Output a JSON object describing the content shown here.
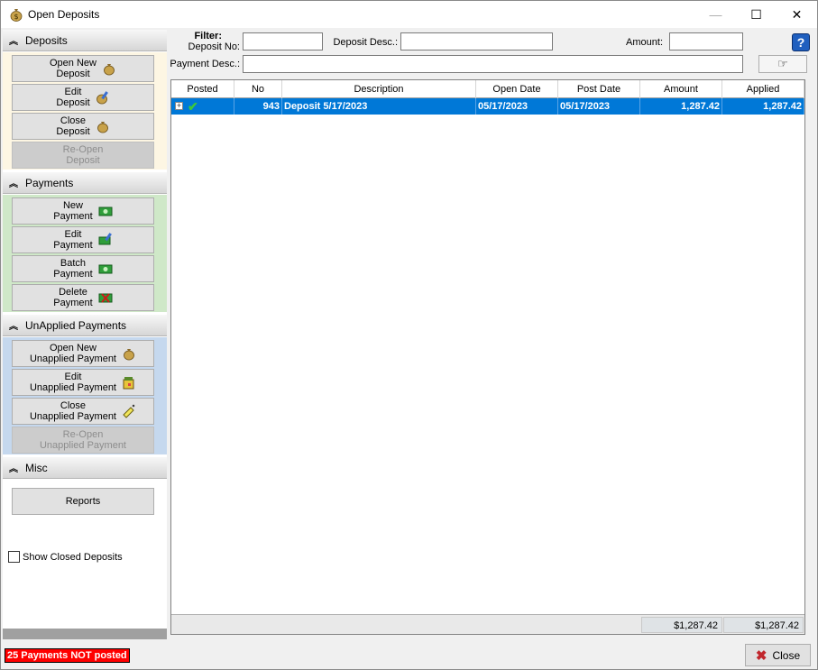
{
  "window": {
    "title": "Open Deposits"
  },
  "nav": {
    "deposits": {
      "title": "Deposits",
      "buttons": [
        {
          "label1": "Open New",
          "label2": "Deposit",
          "icon": "money-bag-icon",
          "disabled": false
        },
        {
          "label1": "Edit",
          "label2": "Deposit",
          "icon": "edit-money-bag-icon",
          "disabled": false
        },
        {
          "label1": "Close",
          "label2": "Deposit",
          "icon": "money-bag-icon",
          "disabled": false
        },
        {
          "label1": "Re-Open",
          "label2": "Deposit",
          "icon": "",
          "disabled": true
        }
      ]
    },
    "payments": {
      "title": "Payments",
      "buttons": [
        {
          "label1": "New",
          "label2": "Payment",
          "icon": "cash-icon"
        },
        {
          "label1": "Edit",
          "label2": "Payment",
          "icon": "edit-cash-icon"
        },
        {
          "label1": "Batch",
          "label2": "Payment",
          "icon": "cash-icon"
        },
        {
          "label1": "Delete",
          "label2": "Payment",
          "icon": "delete-cash-icon"
        }
      ]
    },
    "unapplied": {
      "title": "UnApplied Payments",
      "buttons": [
        {
          "label1": "Open New",
          "label2": "Unapplied Payment",
          "icon": "money-bag-icon",
          "disabled": false
        },
        {
          "label1": "Edit",
          "label2": "Unapplied Payment",
          "icon": "edit-icon",
          "disabled": false
        },
        {
          "label1": "Close",
          "label2": "Unapplied Payment",
          "icon": "close-icon",
          "disabled": false
        },
        {
          "label1": "Re-Open",
          "label2": "Unapplied Payment",
          "icon": "",
          "disabled": true
        }
      ]
    },
    "misc": {
      "title": "Misc",
      "reports_label": "Reports",
      "show_closed_label": "Show Closed Deposits"
    }
  },
  "filter": {
    "title": "Filter:",
    "deposit_no_label": "Deposit No:",
    "deposit_desc_label": "Deposit Desc.:",
    "amount_label": "Amount:",
    "payment_desc_label": "Payment Desc.:",
    "deposit_no_value": "",
    "deposit_desc_value": "",
    "amount_value": "",
    "payment_desc_value": ""
  },
  "grid": {
    "columns": [
      "Posted",
      "No",
      "Description",
      "Open Date",
      "Post Date",
      "Amount",
      "Applied"
    ],
    "rows": [
      {
        "expander": "+",
        "no": "943",
        "description": "Deposit 5/17/2023",
        "open_date": "05/17/2023",
        "post_date": "05/17/2023",
        "amount": "1,287.42",
        "applied": "1,287.42"
      }
    ],
    "totals": {
      "amount": "$1,287.42",
      "applied": "$1,287.42"
    }
  },
  "status": {
    "message": "25 Payments NOT posted"
  },
  "footer": {
    "close_label": "Close"
  },
  "colors": {
    "selection": "#0078d7",
    "deposits_bg": "#fdf6e3",
    "payments_bg": "#cfe8c8",
    "unapplied_bg": "#c5d8ee",
    "status_bg": "#ff0000"
  }
}
